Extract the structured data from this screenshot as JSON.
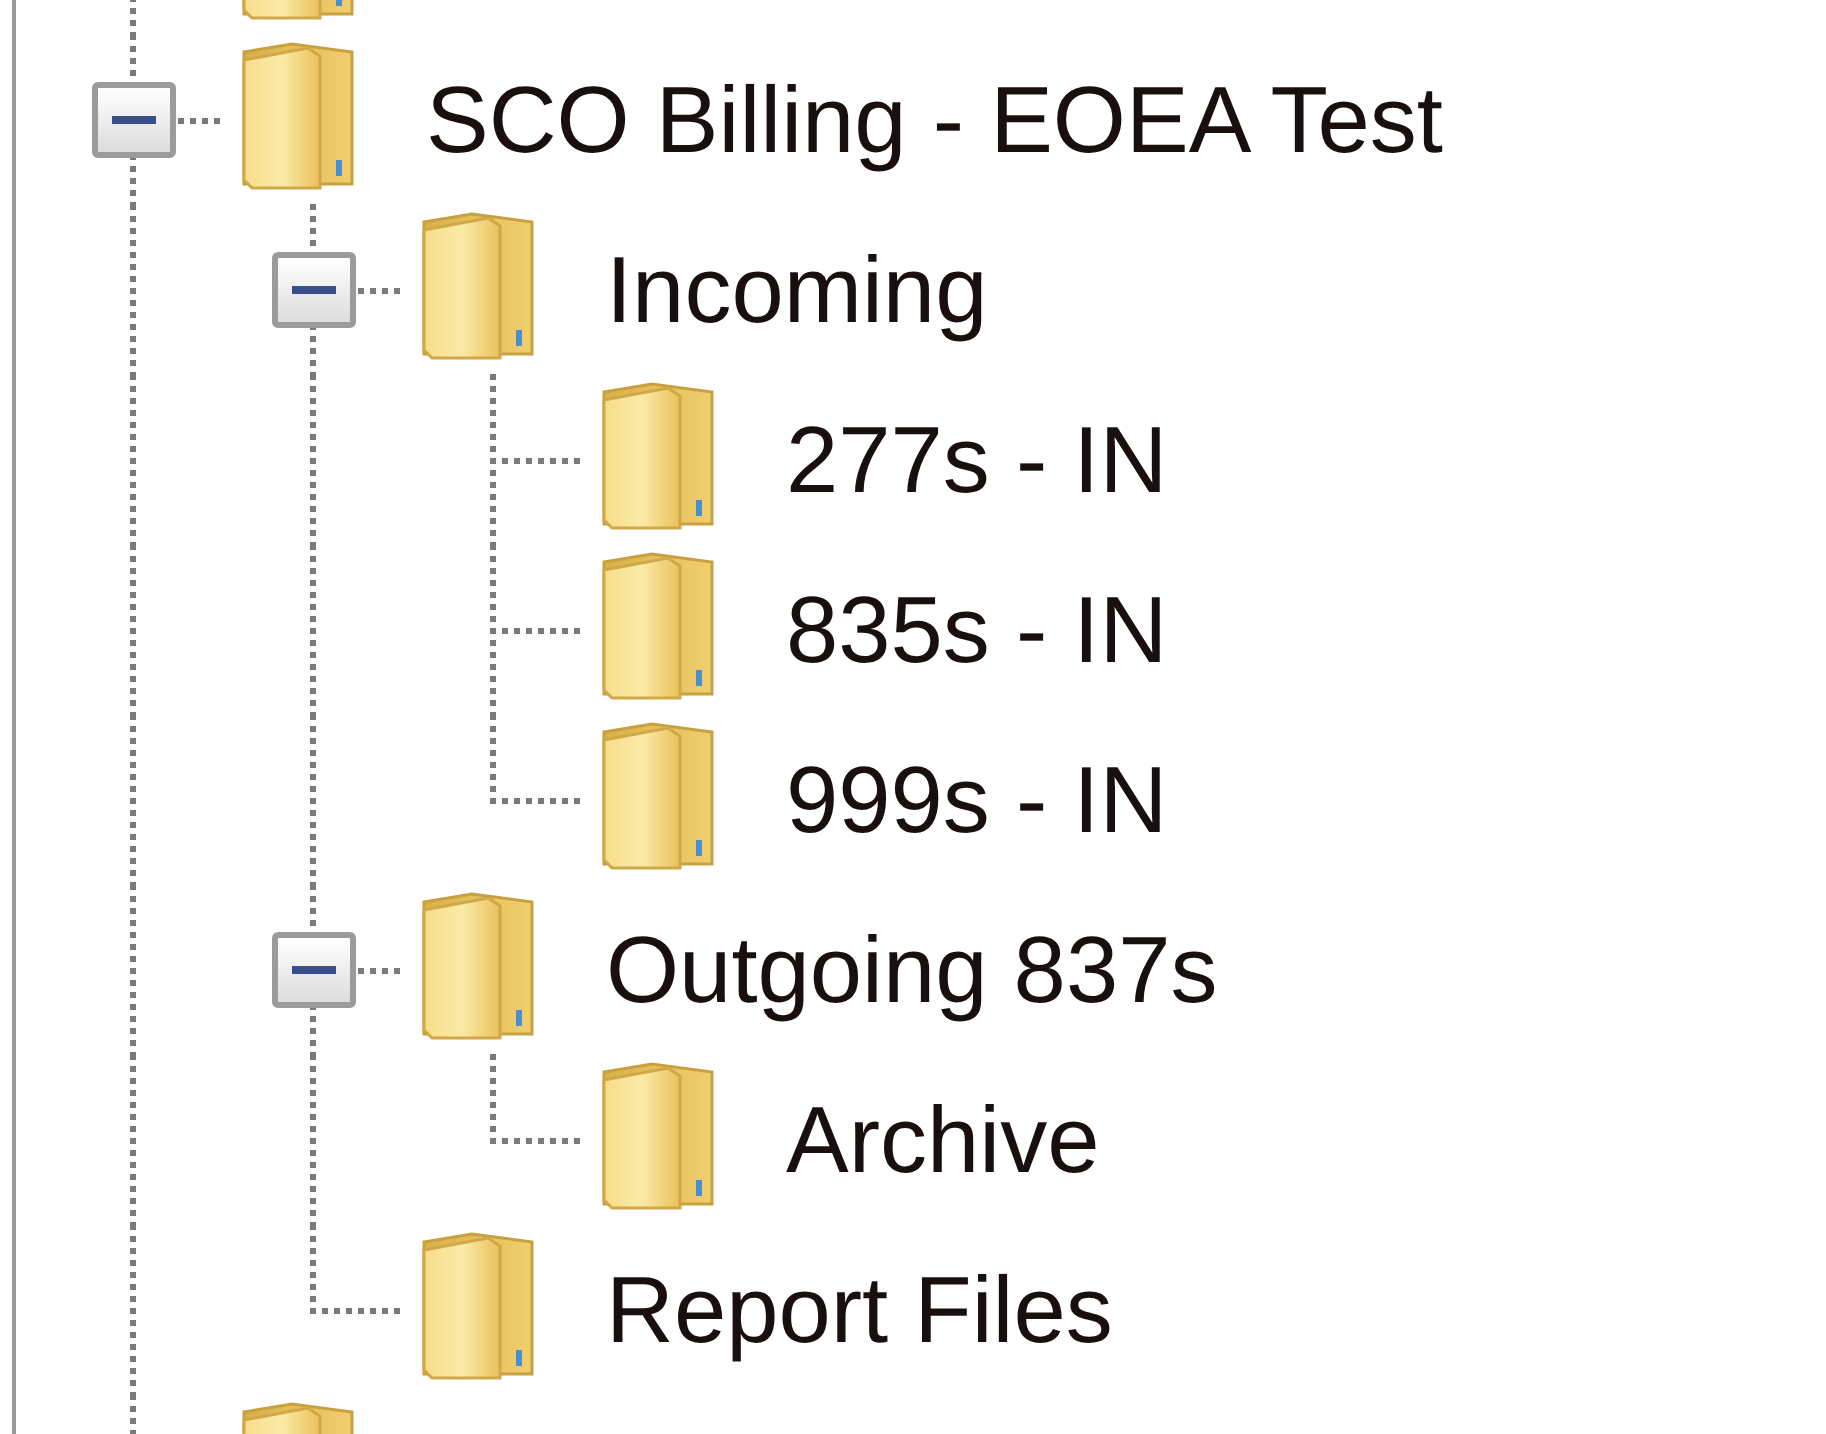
{
  "tree": {
    "items": [
      {
        "kind": "cut_off_folder"
      },
      {
        "kind": "folder",
        "label": "SCO Billing - EOEA Test",
        "expanded": true,
        "children": [
          {
            "kind": "folder",
            "label": "Incoming",
            "expanded": true,
            "children": [
              {
                "kind": "folder",
                "label": "277s - IN"
              },
              {
                "kind": "folder",
                "label": "835s - IN"
              },
              {
                "kind": "folder",
                "label": "999s - IN"
              }
            ]
          },
          {
            "kind": "folder",
            "label": "Outgoing 837s",
            "expanded": true,
            "children": [
              {
                "kind": "folder",
                "label": "Archive"
              }
            ]
          },
          {
            "kind": "folder",
            "label": "Report Files"
          }
        ]
      },
      {
        "kind": "cut_off_folder"
      }
    ]
  }
}
